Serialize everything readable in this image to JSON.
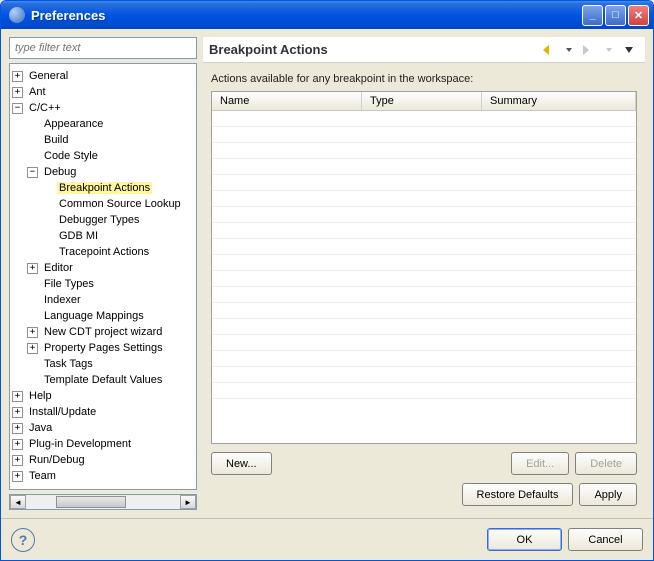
{
  "window": {
    "title": "Preferences"
  },
  "filter": {
    "placeholder": "type filter text"
  },
  "tree": [
    {
      "lvl": 0,
      "exp": "+",
      "label": "General"
    },
    {
      "lvl": 0,
      "exp": "+",
      "label": "Ant"
    },
    {
      "lvl": 0,
      "exp": "-",
      "label": "C/C++"
    },
    {
      "lvl": 1,
      "exp": "",
      "label": "Appearance"
    },
    {
      "lvl": 1,
      "exp": "",
      "label": "Build"
    },
    {
      "lvl": 1,
      "exp": "",
      "label": "Code Style"
    },
    {
      "lvl": 1,
      "exp": "-",
      "label": "Debug"
    },
    {
      "lvl": 2,
      "exp": "",
      "label": "Breakpoint Actions",
      "selected": true
    },
    {
      "lvl": 2,
      "exp": "",
      "label": "Common Source Lookup"
    },
    {
      "lvl": 2,
      "exp": "",
      "label": "Debugger Types"
    },
    {
      "lvl": 2,
      "exp": "",
      "label": "GDB MI"
    },
    {
      "lvl": 2,
      "exp": "",
      "label": "Tracepoint Actions"
    },
    {
      "lvl": 1,
      "exp": "+",
      "label": "Editor"
    },
    {
      "lvl": 1,
      "exp": "",
      "label": "File Types"
    },
    {
      "lvl": 1,
      "exp": "",
      "label": "Indexer"
    },
    {
      "lvl": 1,
      "exp": "",
      "label": "Language Mappings"
    },
    {
      "lvl": 1,
      "exp": "+",
      "label": "New CDT project wizard"
    },
    {
      "lvl": 1,
      "exp": "+",
      "label": "Property Pages Settings"
    },
    {
      "lvl": 1,
      "exp": "",
      "label": "Task Tags"
    },
    {
      "lvl": 1,
      "exp": "",
      "label": "Template Default Values"
    },
    {
      "lvl": 0,
      "exp": "+",
      "label": "Help"
    },
    {
      "lvl": 0,
      "exp": "+",
      "label": "Install/Update"
    },
    {
      "lvl": 0,
      "exp": "+",
      "label": "Java"
    },
    {
      "lvl": 0,
      "exp": "+",
      "label": "Plug-in Development"
    },
    {
      "lvl": 0,
      "exp": "+",
      "label": "Run/Debug"
    },
    {
      "lvl": 0,
      "exp": "+",
      "label": "Team"
    }
  ],
  "page": {
    "title": "Breakpoint Actions",
    "subtext": "Actions available for any breakpoint in the workspace:",
    "columns": {
      "name": "Name",
      "type": "Type",
      "summary": "Summary"
    }
  },
  "buttons": {
    "new": "New...",
    "edit": "Edit...",
    "delete": "Delete",
    "restore": "Restore Defaults",
    "apply": "Apply",
    "ok": "OK",
    "cancel": "Cancel"
  }
}
